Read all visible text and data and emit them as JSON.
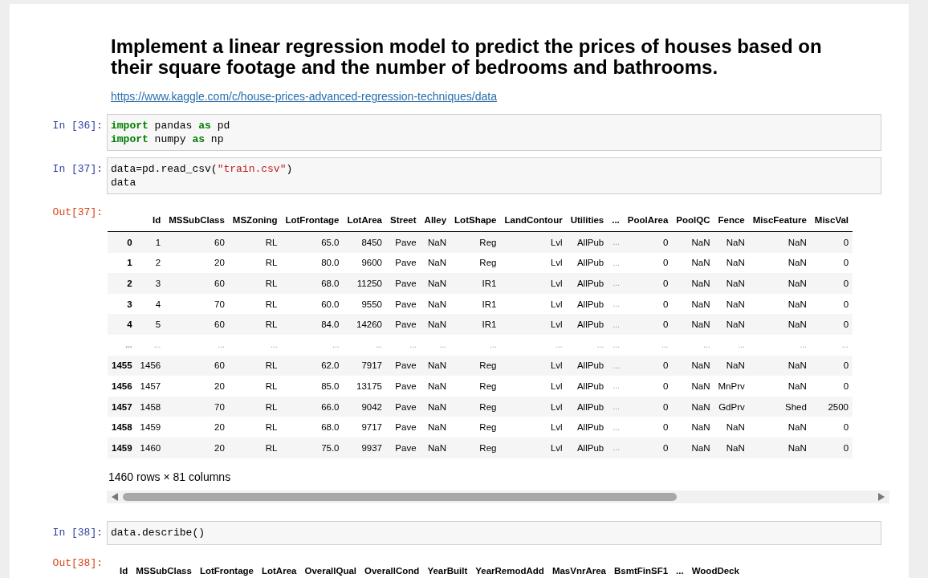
{
  "heading": "Implement a linear regression model to predict the prices of houses based on their square footage and the number of bedrooms and bathrooms.",
  "link": "https://www.kaggle.com/c/house-prices-advanced-regression-techniques/data",
  "cells": [
    {
      "prompt": "In [36]:",
      "lines": [
        [
          {
            "kind": "keyword",
            "text": "import"
          },
          {
            "kind": "plain",
            "text": " pandas "
          },
          {
            "kind": "keyword",
            "text": "as"
          },
          {
            "kind": "plain",
            "text": " pd"
          }
        ],
        [
          {
            "kind": "keyword",
            "text": "import"
          },
          {
            "kind": "plain",
            "text": " numpy "
          },
          {
            "kind": "keyword",
            "text": "as"
          },
          {
            "kind": "plain",
            "text": " np"
          }
        ]
      ]
    },
    {
      "prompt": "In [37]:",
      "lines": [
        [
          {
            "kind": "plain",
            "text": "data=pd.read_csv("
          },
          {
            "kind": "string",
            "text": "\"train.csv\""
          },
          {
            "kind": "plain",
            "text": ")"
          }
        ],
        [
          {
            "kind": "plain",
            "text": "data"
          }
        ]
      ],
      "output": {
        "prompt": "Out[37]:",
        "columns": [
          "Id",
          "MSSubClass",
          "MSZoning",
          "LotFrontage",
          "LotArea",
          "Street",
          "Alley",
          "LotShape",
          "LandContour",
          "Utilities",
          "...",
          "PoolArea",
          "PoolQC",
          "Fence",
          "MiscFeature",
          "MiscVal"
        ],
        "rows": [
          {
            "kind": "data",
            "index": "0",
            "cells": [
              "1",
              "60",
              "RL",
              "65.0",
              "8450",
              "Pave",
              "NaN",
              "Reg",
              "Lvl",
              "AllPub",
              "...",
              "0",
              "NaN",
              "NaN",
              "NaN",
              "0"
            ]
          },
          {
            "kind": "data",
            "index": "1",
            "cells": [
              "2",
              "20",
              "RL",
              "80.0",
              "9600",
              "Pave",
              "NaN",
              "Reg",
              "Lvl",
              "AllPub",
              "...",
              "0",
              "NaN",
              "NaN",
              "NaN",
              "0"
            ]
          },
          {
            "kind": "data",
            "index": "2",
            "cells": [
              "3",
              "60",
              "RL",
              "68.0",
              "11250",
              "Pave",
              "NaN",
              "IR1",
              "Lvl",
              "AllPub",
              "...",
              "0",
              "NaN",
              "NaN",
              "NaN",
              "0"
            ]
          },
          {
            "kind": "data",
            "index": "3",
            "cells": [
              "4",
              "70",
              "RL",
              "60.0",
              "9550",
              "Pave",
              "NaN",
              "IR1",
              "Lvl",
              "AllPub",
              "...",
              "0",
              "NaN",
              "NaN",
              "NaN",
              "0"
            ]
          },
          {
            "kind": "data",
            "index": "4",
            "cells": [
              "5",
              "60",
              "RL",
              "84.0",
              "14260",
              "Pave",
              "NaN",
              "IR1",
              "Lvl",
              "AllPub",
              "...",
              "0",
              "NaN",
              "NaN",
              "NaN",
              "0"
            ]
          },
          {
            "kind": "ellipsis",
            "index": "...",
            "cells": [
              "...",
              "...",
              "...",
              "...",
              "...",
              "...",
              "...",
              "...",
              "...",
              "...",
              "...",
              "...",
              "...",
              "...",
              "...",
              "..."
            ]
          },
          {
            "kind": "data",
            "index": "1455",
            "cells": [
              "1456",
              "60",
              "RL",
              "62.0",
              "7917",
              "Pave",
              "NaN",
              "Reg",
              "Lvl",
              "AllPub",
              "...",
              "0",
              "NaN",
              "NaN",
              "NaN",
              "0"
            ]
          },
          {
            "kind": "data",
            "index": "1456",
            "cells": [
              "1457",
              "20",
              "RL",
              "85.0",
              "13175",
              "Pave",
              "NaN",
              "Reg",
              "Lvl",
              "AllPub",
              "...",
              "0",
              "NaN",
              "MnPrv",
              "NaN",
              "0"
            ]
          },
          {
            "kind": "data",
            "index": "1457",
            "cells": [
              "1458",
              "70",
              "RL",
              "66.0",
              "9042",
              "Pave",
              "NaN",
              "Reg",
              "Lvl",
              "AllPub",
              "...",
              "0",
              "NaN",
              "GdPrv",
              "Shed",
              "2500"
            ]
          },
          {
            "kind": "data",
            "index": "1458",
            "cells": [
              "1459",
              "20",
              "RL",
              "68.0",
              "9717",
              "Pave",
              "NaN",
              "Reg",
              "Lvl",
              "AllPub",
              "...",
              "0",
              "NaN",
              "NaN",
              "NaN",
              "0"
            ]
          },
          {
            "kind": "data",
            "index": "1459",
            "cells": [
              "1460",
              "20",
              "RL",
              "75.0",
              "9937",
              "Pave",
              "NaN",
              "Reg",
              "Lvl",
              "AllPub",
              "...",
              "0",
              "NaN",
              "NaN",
              "NaN",
              "0"
            ]
          }
        ],
        "caption": "1460 rows × 81 columns",
        "scrollbar": true
      }
    },
    {
      "prompt": "In [38]:",
      "lines": [
        [
          {
            "kind": "plain",
            "text": "data.describe()"
          }
        ]
      ],
      "output": {
        "prompt": "Out[38]:",
        "columns": [
          "Id",
          "MSSubClass",
          "LotFrontage",
          "LotArea",
          "OverallQual",
          "OverallCond",
          "YearBuilt",
          "YearRemodAdd",
          "MasVnrArea",
          "BsmtFinSF1",
          "...",
          "WoodDeck"
        ]
      }
    }
  ]
}
